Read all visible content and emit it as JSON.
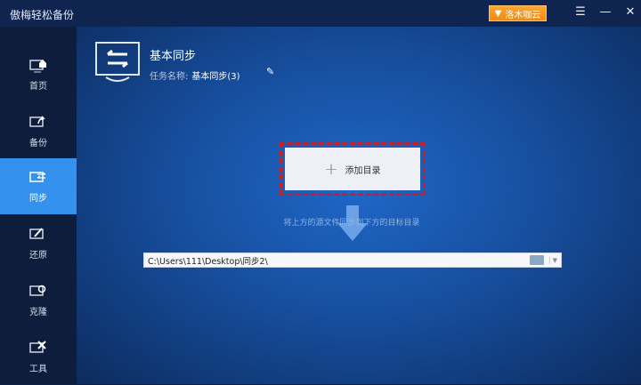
{
  "app": {
    "title": "傲梅轻松备份",
    "vip_label": "洛木咖云",
    "menu_icon": "☰",
    "minimize": "—",
    "close": "✕"
  },
  "sidebar": {
    "items": [
      {
        "label": "首页"
      },
      {
        "label": "备份"
      },
      {
        "label": "同步",
        "active": true
      },
      {
        "label": "还原"
      },
      {
        "label": "克隆"
      },
      {
        "label": "工具"
      }
    ]
  },
  "header": {
    "title": "基本同步",
    "task_label": "任务名称:",
    "task_name": "基本同步(3)"
  },
  "source": {
    "add_label": "添加目录"
  },
  "hint": "将上方的源文件同步到下方的目标目录",
  "destination": {
    "path": "C:\\Users\\111\\Desktop\\同步2\\"
  },
  "colors": {
    "accent": "#3492ee",
    "vip": "#f39418",
    "highlight": "#c4202a"
  }
}
